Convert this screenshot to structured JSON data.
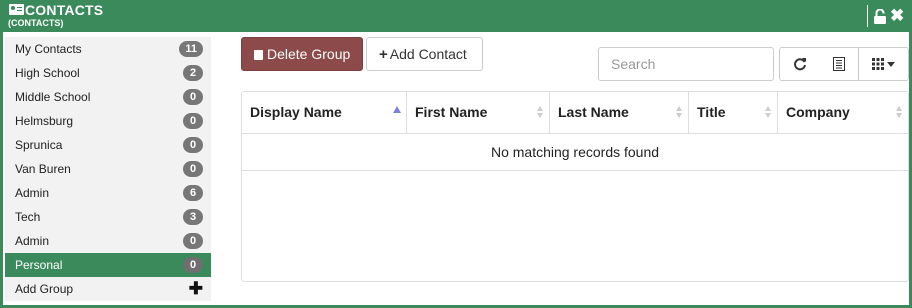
{
  "window": {
    "title": "CONTACTS",
    "subtitle": "(CONTACTS)",
    "icons": {
      "title": "contact-card-icon",
      "lock": "unlock-icon",
      "close": "close-icon"
    },
    "accent_color": "#3a8a5c"
  },
  "sidebar": {
    "items": [
      {
        "label": "My Contacts",
        "count": "11"
      },
      {
        "label": "High School",
        "count": "2"
      },
      {
        "label": "Middle School",
        "count": "0"
      },
      {
        "label": "Helmsburg",
        "count": "0"
      },
      {
        "label": "Sprunica",
        "count": "0"
      },
      {
        "label": "Van Buren",
        "count": "0"
      },
      {
        "label": "Admin",
        "count": "6"
      },
      {
        "label": "Tech",
        "count": "3"
      },
      {
        "label": "Admin",
        "count": "0"
      },
      {
        "label": "Personal",
        "count": "0",
        "active": true
      }
    ],
    "add_group_label": "Add Group"
  },
  "toolbar": {
    "delete_group_label": "Delete Group",
    "add_contact_label": "Add Contact",
    "delete_group_color": "#8c4a4a",
    "search_placeholder": "Search",
    "search_value": "",
    "icons": [
      "refresh-icon",
      "columns-icon",
      "grid-icon"
    ]
  },
  "table": {
    "columns": [
      {
        "label": "Display Name",
        "sort": "ascending"
      },
      {
        "label": "First Name",
        "sort": "none"
      },
      {
        "label": "Last Name",
        "sort": "none"
      },
      {
        "label": "Title",
        "sort": "none"
      },
      {
        "label": "Company",
        "sort": "none"
      }
    ],
    "empty_message": "No matching records found"
  }
}
